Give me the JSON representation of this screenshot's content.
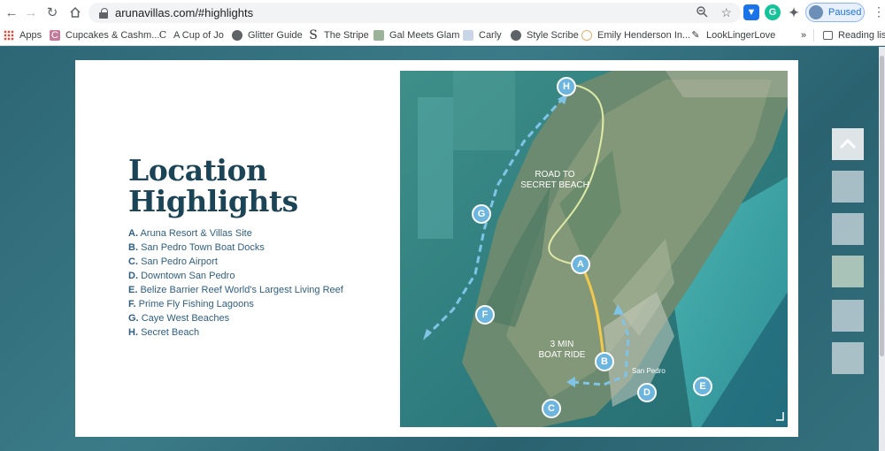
{
  "browser": {
    "url": "arunavillas.com/#highlights",
    "profile_label": "Paused"
  },
  "bookmarks": {
    "apps": "Apps",
    "items": [
      "Cupcakes & Cashm...",
      "A Cup of Jo",
      "Glitter Guide",
      "The Stripe",
      "Gal Meets Glam",
      "Carly",
      "Style Scribe",
      "Emily Henderson In...",
      "LookLingerLove"
    ],
    "overflow": "»",
    "reading_list": "Reading list"
  },
  "section": {
    "title_line1": "Location",
    "title_line2": "Highlights",
    "items": [
      {
        "letter": "A.",
        "text": "Aruna Resort & Villas Site"
      },
      {
        "letter": "B.",
        "text": "San Pedro Town Boat Docks"
      },
      {
        "letter": "C.",
        "text": "San Pedro Airport"
      },
      {
        "letter": "D.",
        "text": "Downtown San Pedro"
      },
      {
        "letter": "E.",
        "text": "Belize Barrier Reef World's Largest Living Reef"
      },
      {
        "letter": "F.",
        "text": "Prime Fly Fishing Lagoons"
      },
      {
        "letter": "G.",
        "text": "Caye West Beaches"
      },
      {
        "letter": "H.",
        "text": "Secret Beach"
      }
    ]
  },
  "map": {
    "road_label_1": "ROAD TO",
    "road_label_2": "SECRET BEACH",
    "boat_label_1": "3 MIN",
    "boat_label_2": "BOAT RIDE",
    "town_label": "San Pedro",
    "markers": [
      "A",
      "B",
      "C",
      "D",
      "E",
      "F",
      "G",
      "H"
    ]
  },
  "colors": {
    "title": "#1c4457",
    "list_text": "#2e5f82",
    "marker": "#6cb5de",
    "road": "#dfe9a6",
    "boat": "#f2c94c"
  }
}
